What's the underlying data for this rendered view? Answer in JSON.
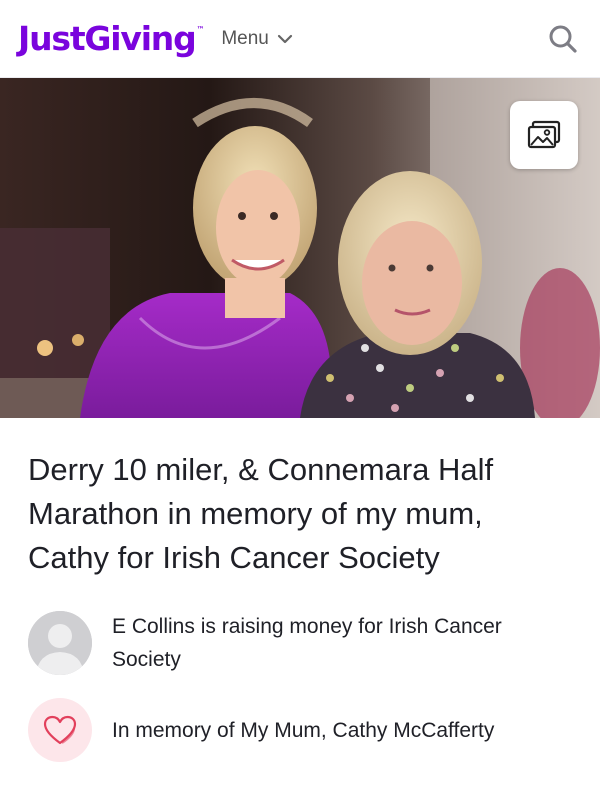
{
  "header": {
    "logo_text": "JustGiving",
    "logo_tm": "™",
    "menu_label": "Menu",
    "search_icon": "search-icon",
    "brand_color": "#7a04dd"
  },
  "hero": {
    "gallery_icon": "image-gallery-icon"
  },
  "page": {
    "title": "Derry 10 miler, & Connemara Half Marathon in memory of my mum, Cathy for Irish Cancer Society",
    "fundraiser_text": "E Collins is raising money for Irish Cancer Society",
    "memory_text": "In memory of My Mum, Cathy McCafferty",
    "memory_icon": "heart-icon",
    "memory_accent": "#e2405c"
  }
}
